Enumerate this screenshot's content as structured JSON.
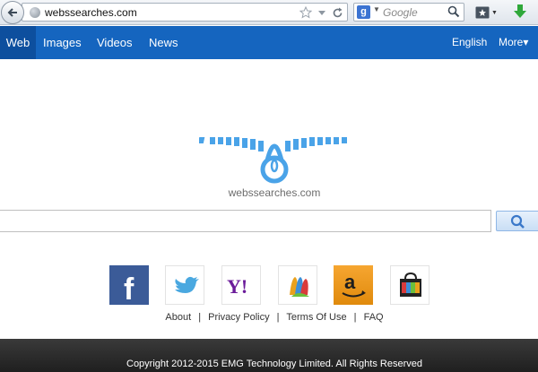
{
  "browser": {
    "url": "webssearches.com",
    "search_engine_letter": "g",
    "search_placeholder": "Google",
    "icons": [
      "back-arrow-icon",
      "globe-icon",
      "star-icon",
      "dropdown-icon",
      "reload-icon",
      "search-icon",
      "bookmarks-icon",
      "download-icon"
    ]
  },
  "nav": {
    "items": [
      {
        "label": "Web",
        "active": true
      },
      {
        "label": "Images"
      },
      {
        "label": "Videos"
      },
      {
        "label": "News"
      }
    ],
    "language": "English",
    "more": "More▾"
  },
  "logo": {
    "text": "webssearches.com"
  },
  "search": {
    "value": "",
    "button_icon": "search-icon"
  },
  "social": {
    "items": [
      {
        "name": "facebook",
        "glyph": "f",
        "color": "#3b5b98"
      },
      {
        "name": "twitter",
        "color": "#4aa8e0"
      },
      {
        "name": "yahoo",
        "glyph": "Y!",
        "color": "#6b1b9a"
      },
      {
        "name": "msn",
        "color": "#e9a11d"
      },
      {
        "name": "amazon",
        "glyph": "a",
        "color": "#f29a1f"
      },
      {
        "name": "shopping",
        "color": "#c0392b"
      }
    ]
  },
  "footer_links": {
    "about": "About",
    "privacy": "Privacy Policy",
    "terms": "Terms Of Use",
    "faq": "FAQ",
    "separator": "|"
  },
  "footer": {
    "copyright": "Copyright 2012-2015 EMG Technology Limited. All Rights Reserved"
  },
  "colors": {
    "nav_bg": "#1565bf",
    "nav_active": "#0d4f9e",
    "logo_blue": "#4aa3e8",
    "footer_bg": "#262626"
  }
}
